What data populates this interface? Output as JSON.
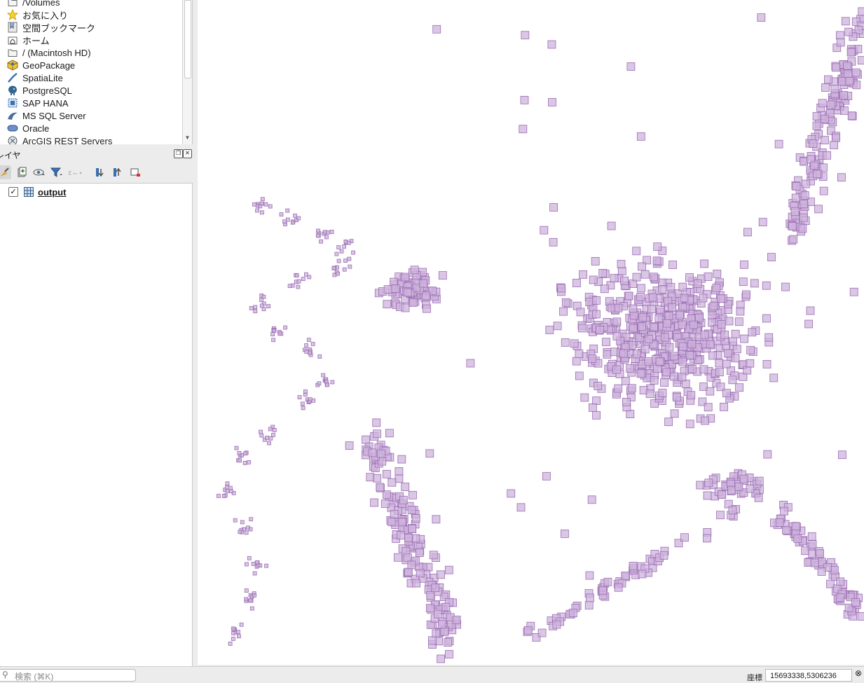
{
  "browser": {
    "items": [
      {
        "label": "/Volumes",
        "icon": "folder-icon"
      },
      {
        "label": "お気に入り",
        "icon": "star-icon"
      },
      {
        "label": "空間ブックマーク",
        "icon": "bookmark-icon"
      },
      {
        "label": "ホーム",
        "icon": "home-folder-icon"
      },
      {
        "label": "/ (Macintosh HD)",
        "icon": "folder-icon"
      },
      {
        "label": "GeoPackage",
        "icon": "geopackage-icon"
      },
      {
        "label": "SpatiaLite",
        "icon": "spatialite-icon"
      },
      {
        "label": "PostgreSQL",
        "icon": "postgresql-icon"
      },
      {
        "label": "SAP HANA",
        "icon": "sap-hana-icon"
      },
      {
        "label": "MS SQL Server",
        "icon": "mssql-icon"
      },
      {
        "label": "Oracle",
        "icon": "oracle-icon"
      },
      {
        "label": "ArcGIS REST Servers",
        "icon": "arcgis-rest-icon"
      }
    ]
  },
  "layers": {
    "title": "レイヤ",
    "layer": {
      "name": "output",
      "checked": "✓",
      "icon": "table-grid-icon"
    }
  },
  "map": {
    "fill": "#cdb3dc",
    "stroke": "#9b6fb3"
  },
  "status": {
    "search_placeholder": "検索 (⌘K)",
    "coord_label": "座標",
    "coord_value": "15693338,5306236"
  }
}
